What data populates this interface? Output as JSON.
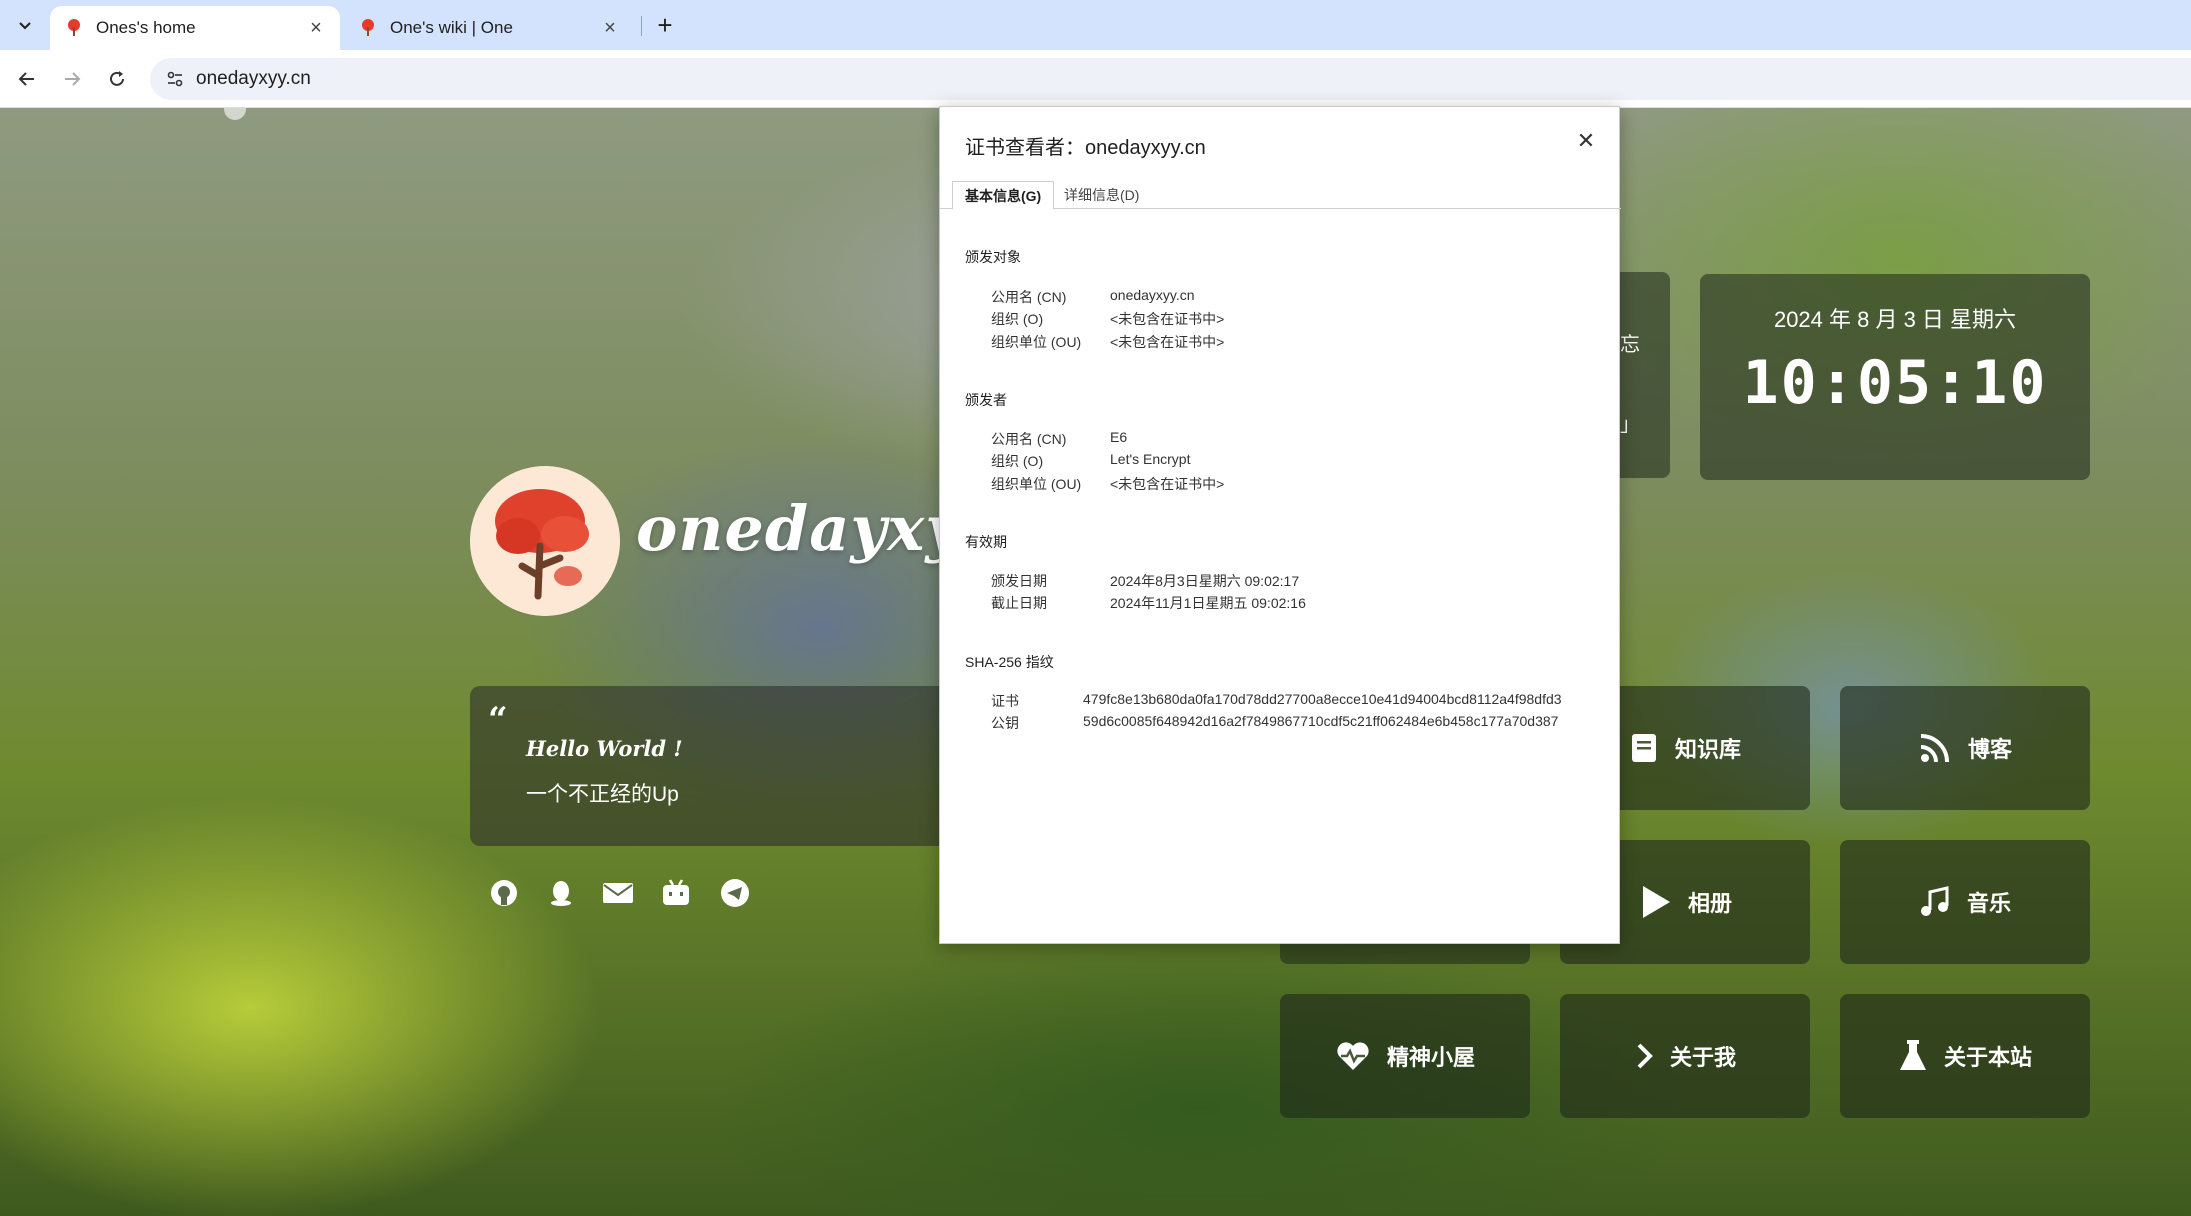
{
  "browser": {
    "tabs": [
      {
        "title": "Ones's home",
        "active": true
      },
      {
        "title": "One's wiki | One",
        "active": false
      }
    ],
    "url": "onedayxyy.cn"
  },
  "page": {
    "logo_text": "onedayxyy.cn",
    "quote": {
      "hello": "Hello World !",
      "sub": "一个不正经的Up"
    },
    "social_icons": [
      "github-icon",
      "qq-icon",
      "mail-icon",
      "bilibili-icon",
      "telegram-icon"
    ],
    "datetime": {
      "date": "2024 年 8 月 3 日 星期六",
      "time": "10:05:10"
    },
    "partial_card_text": [
      "忘",
      "」"
    ],
    "buttons": [
      {
        "label": "知识库",
        "icon": "book-icon"
      },
      {
        "label": "博客",
        "icon": "rss-icon"
      },
      {
        "label": "相册",
        "icon": "play-icon"
      },
      {
        "label": "音乐",
        "icon": "music-icon"
      },
      {
        "label": "精神小屋",
        "icon": "heartbeat-icon"
      },
      {
        "label": "关于我",
        "icon": "chevron-right-icon"
      },
      {
        "label": "关于本站",
        "icon": "flask-icon"
      }
    ]
  },
  "cert_viewer": {
    "title": "证书查看者：onedayxyy.cn",
    "tabs": [
      "基本信息(G)",
      "详细信息(D)"
    ],
    "subject": {
      "heading": "颁发对象",
      "rows": [
        {
          "label": "公用名 (CN)",
          "value": "onedayxyy.cn"
        },
        {
          "label": "组织 (O)",
          "value": "<未包含在证书中>"
        },
        {
          "label": "组织单位 (OU)",
          "value": "<未包含在证书中>"
        }
      ]
    },
    "issuer": {
      "heading": "颁发者",
      "rows": [
        {
          "label": "公用名 (CN)",
          "value": "E6"
        },
        {
          "label": "组织 (O)",
          "value": "Let's Encrypt"
        },
        {
          "label": "组织单位 (OU)",
          "value": "<未包含在证书中>"
        }
      ]
    },
    "validity": {
      "heading": "有效期",
      "rows": [
        {
          "label": "颁发日期",
          "value": "2024年8月3日星期六 09:02:17"
        },
        {
          "label": "截止日期",
          "value": "2024年11月1日星期五 09:02:16"
        }
      ]
    },
    "fingerprints": {
      "heading": "SHA-256 指纹",
      "rows": [
        {
          "label": "证书",
          "value": "479fc8e13b680da0fa170d78dd27700a8ecce10e41d94004bcd8112a4f98dfd3"
        },
        {
          "label": "公钥",
          "value": "59d6c0085f648942d16a2f7849867710cdf5c21ff062484e6b458c177a70d387"
        }
      ]
    }
  }
}
